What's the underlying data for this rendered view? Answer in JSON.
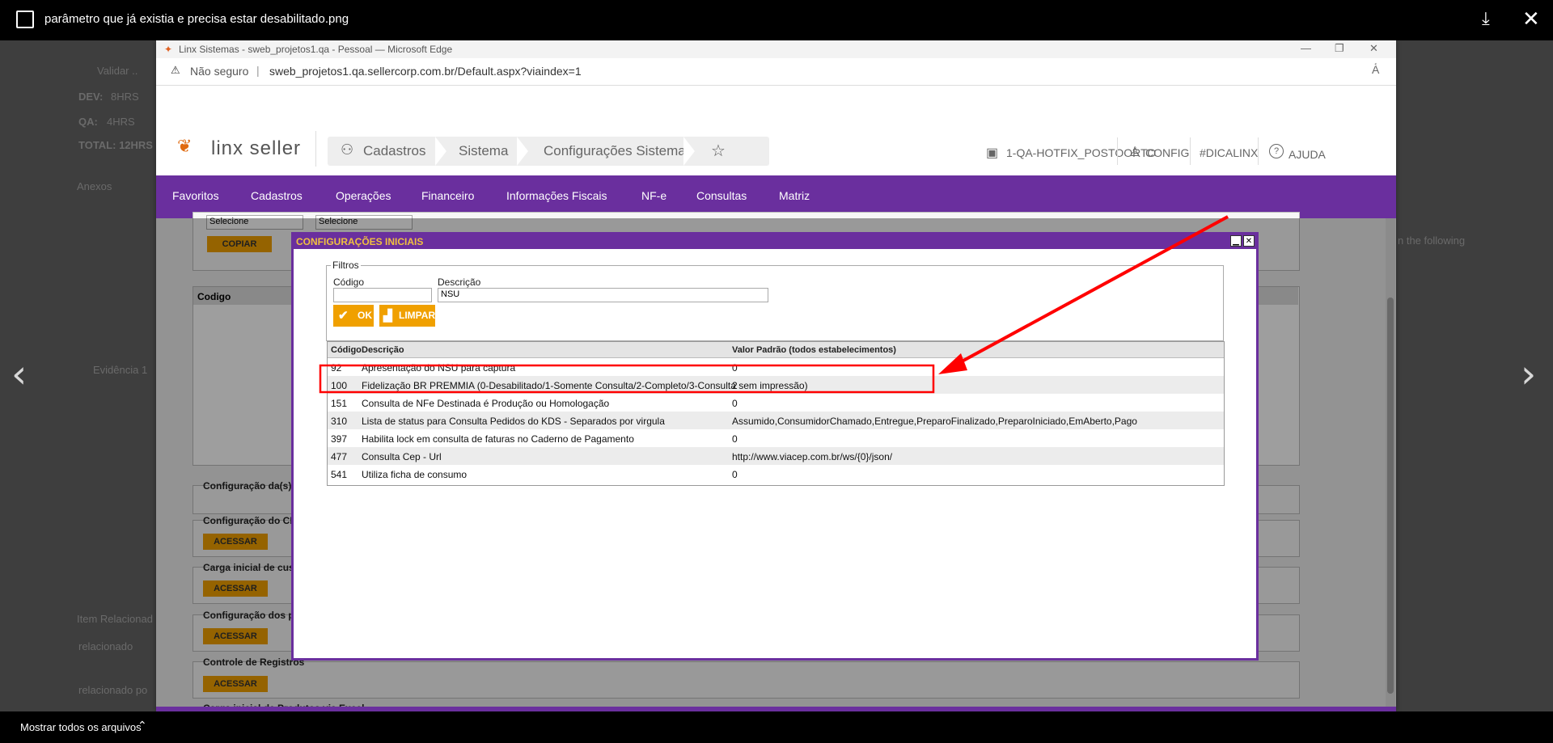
{
  "viewer": {
    "filename": "parâmetro que já existia e precisa estar desabilitado.png",
    "bottom_label": "Mostrar todos os arquivos",
    "background_text": [
      "Validar ..",
      "DEV:",
      "8HRS",
      "QA:",
      "4HRS",
      "TOTAL: 12HRS",
      "Anexos",
      "Evidência 1",
      "Item Relacionad",
      "relacionado",
      "relacionado po",
      "n the following"
    ]
  },
  "browser": {
    "window_title": "Linx Sistemas - sweb_projetos1.qa - Pessoal — Microsoft Edge",
    "security": "Não seguro",
    "url": "sweb_projetos1.qa.sellercorp.com.br/Default.aspx?viaindex=1"
  },
  "app": {
    "logo": "linx seller",
    "breadcrumbs": [
      "Cadastros",
      "Sistema",
      "Configurações Sistema"
    ],
    "header_links": {
      "store": "1-QA-HOTFIX_POSTOORTO",
      "config": "CONFIG",
      "dicalinx": "#DICALINX",
      "help": "AJUDA"
    },
    "menu": [
      "Favoritos",
      "Cadastros",
      "Operações",
      "Financeiro",
      "Informações Fiscais",
      "NF-e",
      "Consultas",
      "Matriz"
    ]
  },
  "page": {
    "select1": "Selecione",
    "select2": "Selecione",
    "copy_button": "COPIAR",
    "grid_header": "Codigo",
    "sections": [
      "Configuração da(s) E",
      "Configuração do CFO",
      "Carga inicial de custo",
      "Configuração dos par",
      "Controle de Registros",
      "Carga inicial de Produtos via Excel"
    ],
    "access_button": "ACESSAR"
  },
  "modal": {
    "title": "CONFIGURAÇÕES INICIAIS",
    "filters_legend": "Filtros",
    "code_label": "Código",
    "code_value": "",
    "desc_label": "Descrição",
    "desc_value": "NSU",
    "ok_label": "OK",
    "clear_label": "LIMPAR",
    "columns": [
      "Código",
      "Descrição",
      "Valor Padrão (todos estabelecimentos)"
    ],
    "rows": [
      {
        "code": "92",
        "desc": "Apresentação do NSU para captura",
        "value": "0",
        "highlighted": true
      },
      {
        "code": "100",
        "desc": "Fidelização BR PREMMIA (0-Desabilitado/1-Somente Consulta/2-Completo/3-Consulta sem impressão)",
        "value": "2"
      },
      {
        "code": "151",
        "desc": "Consulta de NFe Destinada é Produção ou Homologação",
        "value": "0"
      },
      {
        "code": "310",
        "desc": "Lista de status para Consulta Pedidos do KDS - Separados por virgula",
        "value": "Assumido,ConsumidorChamado,Entregue,PreparoFinalizado,PreparoIniciado,EmAberto,Pago"
      },
      {
        "code": "397",
        "desc": "Habilita lock em consulta de faturas no Caderno de Pagamento",
        "value": "0"
      },
      {
        "code": "477",
        "desc": "Consulta Cep - Url",
        "value": "http://www.viacep.com.br/ws/{0}/json/"
      },
      {
        "code": "541",
        "desc": "Utiliza ficha de consumo",
        "value": "0"
      }
    ]
  },
  "colors": {
    "purple": "#6a2f9e",
    "orange": "#f0a000",
    "annotation_red": "#ff0000"
  }
}
